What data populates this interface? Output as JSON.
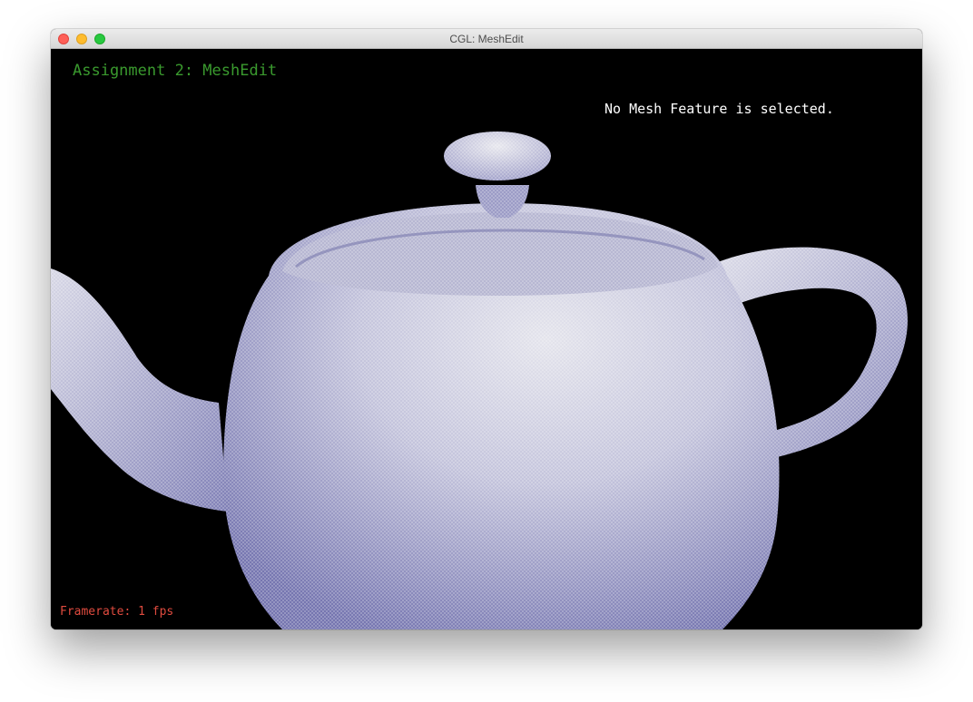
{
  "window": {
    "title": "CGL: MeshEdit"
  },
  "hud": {
    "title": "Assignment 2: MeshEdit",
    "status": "No Mesh Feature is selected.",
    "framerate": "Framerate: 1 fps"
  },
  "colors": {
    "title_text": "#3a9a2e",
    "status_text": "#ffffff",
    "framerate_text": "#e04b3f",
    "mesh_base": "#a6a6d0",
    "mesh_highlight": "#e2e2ea",
    "mesh_shadow": "#6e6ea8",
    "background": "#000000"
  },
  "scene": {
    "model": "teapot"
  }
}
